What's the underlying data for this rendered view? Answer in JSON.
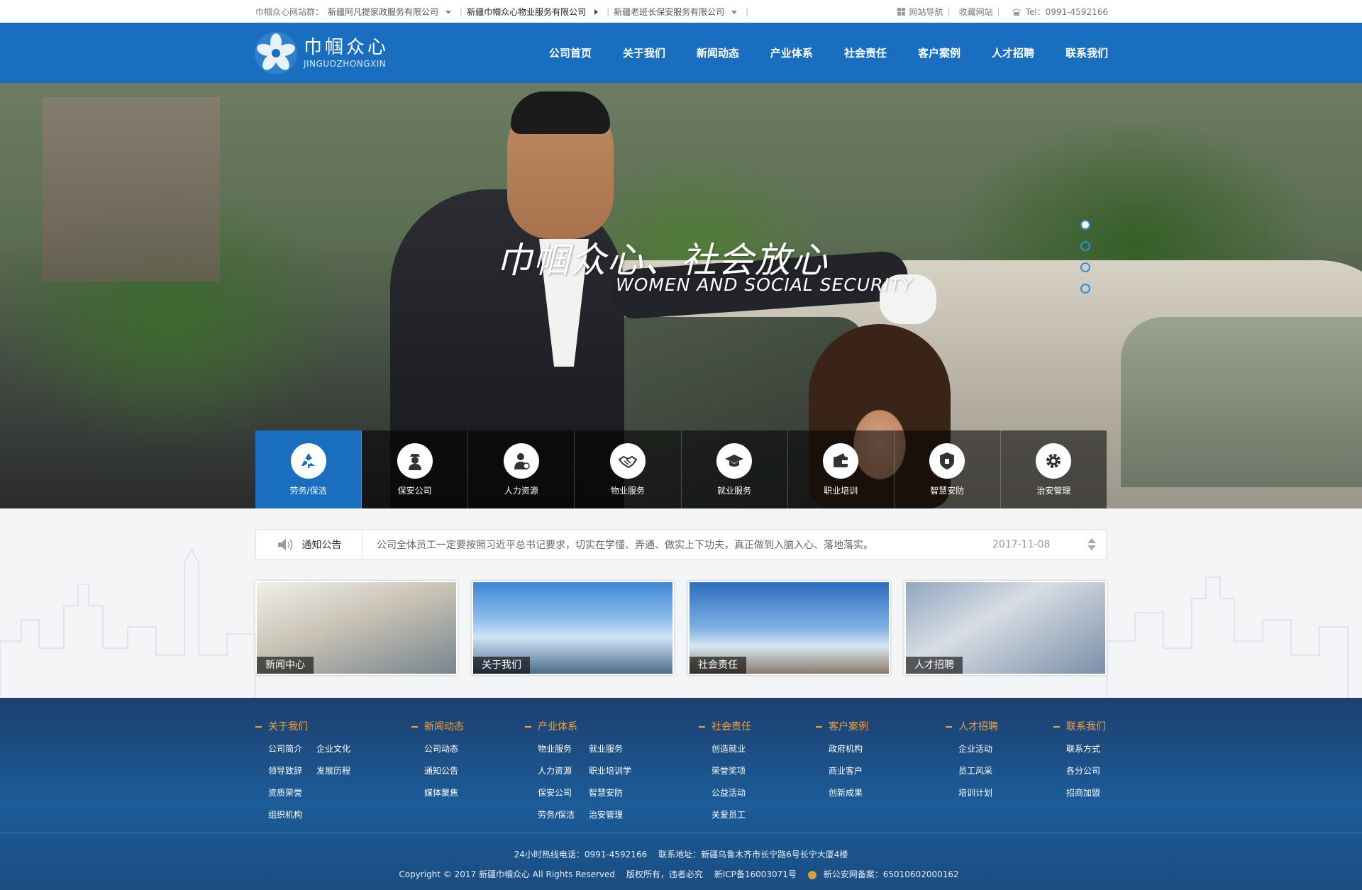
{
  "topbar": {
    "group_label": "巾帼众心网站群：",
    "sites": [
      "新疆阿凡提家政服务有限公司",
      "新疆巾帼众心物业服务有限公司",
      "新疆老班长保安服务有限公司"
    ],
    "site_nav": "网站导航",
    "favorite": "收藏网站",
    "phone": "Tel：0991-4592166"
  },
  "header": {
    "logo_cn": "巾帼众心",
    "logo_en": "JINGUOZHONGXIN",
    "nav": [
      "公司首页",
      "关于我们",
      "新闻动态",
      "产业体系",
      "社会责任",
      "客户案例",
      "人才招聘",
      "联系我们"
    ]
  },
  "banner": {
    "slogan_cn": "巾帼众心、社会放心",
    "slogan_en": "WOMEN AND SOCIAL SECURITY",
    "slides": 4,
    "active_slide": 1
  },
  "services": [
    {
      "label": "劳务/保洁",
      "icon": "recycle-icon",
      "active": true
    },
    {
      "label": "保安公司",
      "icon": "security-guard-icon",
      "active": false
    },
    {
      "label": "人力资源",
      "icon": "person-icon",
      "active": false
    },
    {
      "label": "物业服务",
      "icon": "handshake-icon",
      "active": false
    },
    {
      "label": "就业服务",
      "icon": "graduation-cap-icon",
      "active": false
    },
    {
      "label": "职业培训",
      "icon": "wallet-icon",
      "active": false
    },
    {
      "label": "智慧安防",
      "icon": "shield-icon",
      "active": false
    },
    {
      "label": "治安管理",
      "icon": "gear-icon",
      "active": false
    }
  ],
  "notice": {
    "label": "通知公告",
    "text": "公司全体员工一定要按照习近平总书记要求，切实在学懂、弄通、做实上下功夫，真正做到入脑入心、落地落实。",
    "date": "2017-11-08"
  },
  "cards": [
    {
      "label": "新闻中心"
    },
    {
      "label": "关于我们"
    },
    {
      "label": "社会责任"
    },
    {
      "label": "人才招聘"
    }
  ],
  "footer": {
    "columns": [
      {
        "title": "关于我们",
        "links": [
          "公司简介",
          "企业文化",
          "领导致辞",
          "发展历程",
          "资质荣誉",
          "组织机构"
        ]
      },
      {
        "title": "新闻动态",
        "links": [
          "公司动态",
          "通知公告",
          "媒体聚焦"
        ]
      },
      {
        "title": "产业体系",
        "links": [
          "物业服务",
          "就业服务",
          "人力资源",
          "职业培训学",
          "保安公司",
          "智慧安防",
          "劳务/保洁",
          "治安管理"
        ]
      },
      {
        "title": "社会责任",
        "links": [
          "创造就业",
          "荣誉奖项",
          "公益活动",
          "关爱员工"
        ]
      },
      {
        "title": "客户案例",
        "links": [
          "政府机构",
          "商业客户",
          "创新成果"
        ]
      },
      {
        "title": "人才招聘",
        "links": [
          "企业活动",
          "员工风采",
          "培训计划"
        ]
      },
      {
        "title": "联系我们",
        "links": [
          "联系方式",
          "各分公司",
          "招商加盟"
        ]
      }
    ],
    "hotline": "24小时热线电话：0991-4592166",
    "address": "联系地址：新疆乌鲁木齐市长宁路6号长宁大厦4楼",
    "copyright": "Copyright © 2017  新疆巾帼众心  All Rights Reserved",
    "rights": "版权所有，违者必究",
    "icp": "新ICP备16003071号",
    "police": "新公安网备案：65010602000162"
  },
  "colors": {
    "brand_blue": "#1a6ec0",
    "footer_accent": "#f2a03b"
  }
}
